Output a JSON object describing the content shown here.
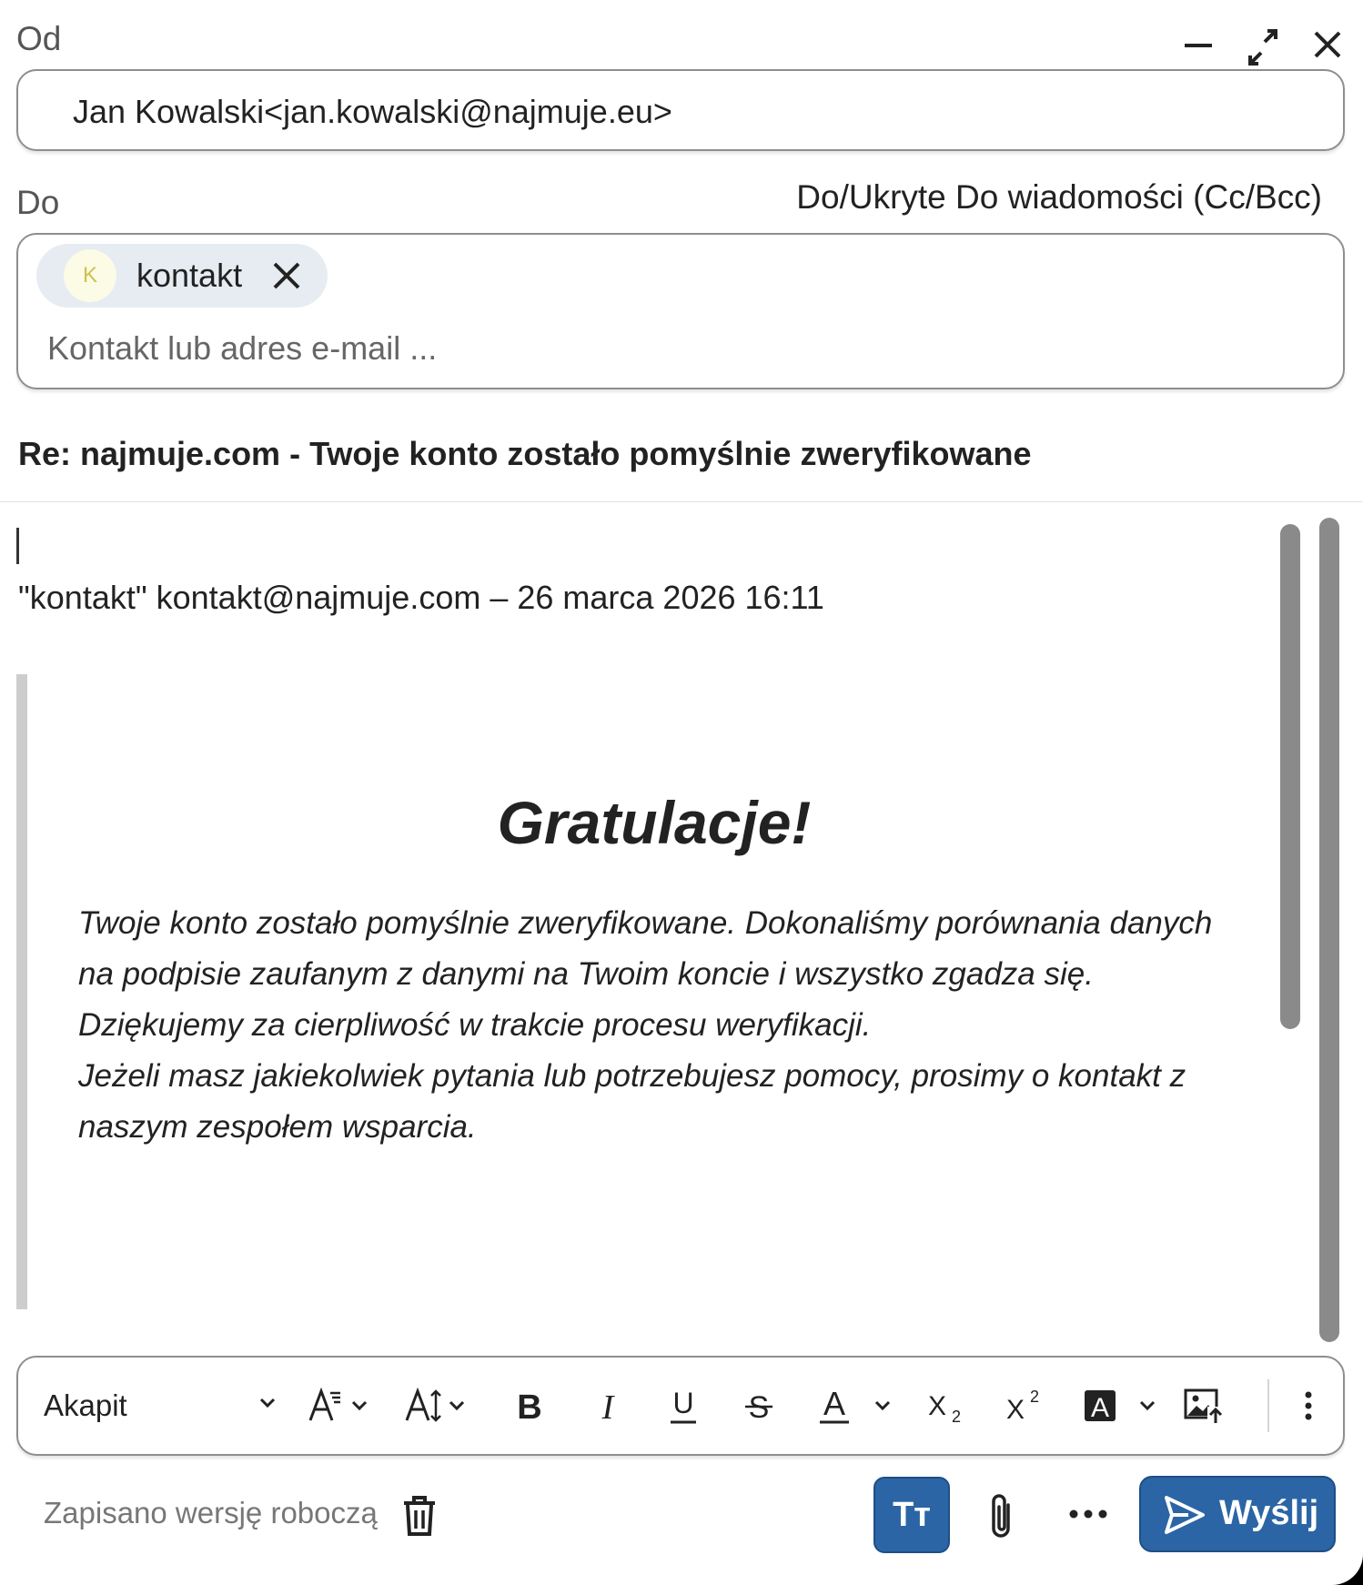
{
  "from": {
    "label": "Od",
    "value": "Jan Kowalski<jan.kowalski@najmuje.eu>"
  },
  "window_controls": [
    "minimize-icon",
    "expand-icon",
    "close-icon"
  ],
  "to": {
    "label": "Do",
    "cc_bcc_link": "Do/Ukryte Do wiadomości (Cc/Bcc)",
    "chips": [
      {
        "initial": "K",
        "name": "kontakt"
      }
    ],
    "placeholder": "Kontakt lub adres e-mail ..."
  },
  "subject": "Re: najmuje.com - Twoje konto zostało pomyślnie zweryfikowane",
  "body": {
    "quote_header": "\"kontakt\" kontakt@najmuje.com – 26 marca 2026 16:11",
    "heading": "Gratulacje!",
    "paragraphs": [
      "Twoje konto zostało pomyślnie zweryfikowane. Dokonaliśmy porównania danych na podpisie zaufanym z danymi na Twoim koncie i wszystko zgadza się.",
      "Dziękujemy za cierpliwość w trakcie procesu weryfikacji.",
      "Jeżeli masz jakiekolwiek pytania lub potrzebujesz pomocy, prosimy o kontakt z naszym zespołem wsparcia."
    ]
  },
  "toolbar": {
    "paragraph_style": "Akapit",
    "bold": "B",
    "italic": "I",
    "underline": "U",
    "strikethrough": "S",
    "font_color": "A",
    "subscript": "X₂",
    "superscript": "X²",
    "highlight": "A",
    "icons": [
      "font-family-icon",
      "font-size-icon",
      "bold-icon",
      "italic-icon",
      "underline-icon",
      "strikethrough-icon",
      "font-color-icon",
      "subscript-icon",
      "superscript-icon",
      "highlight-icon",
      "insert-image-icon",
      "more-vertical-icon"
    ]
  },
  "footer": {
    "draft_status": "Zapisano wersję roboczą",
    "format_button": "Tт",
    "send_label": "Wyślij"
  },
  "colors": {
    "accent": "#2b65a5",
    "avatar_bg": "#fbfbe6",
    "avatar_text": "#cfc24a",
    "chip_bg": "#e6ecf2"
  }
}
